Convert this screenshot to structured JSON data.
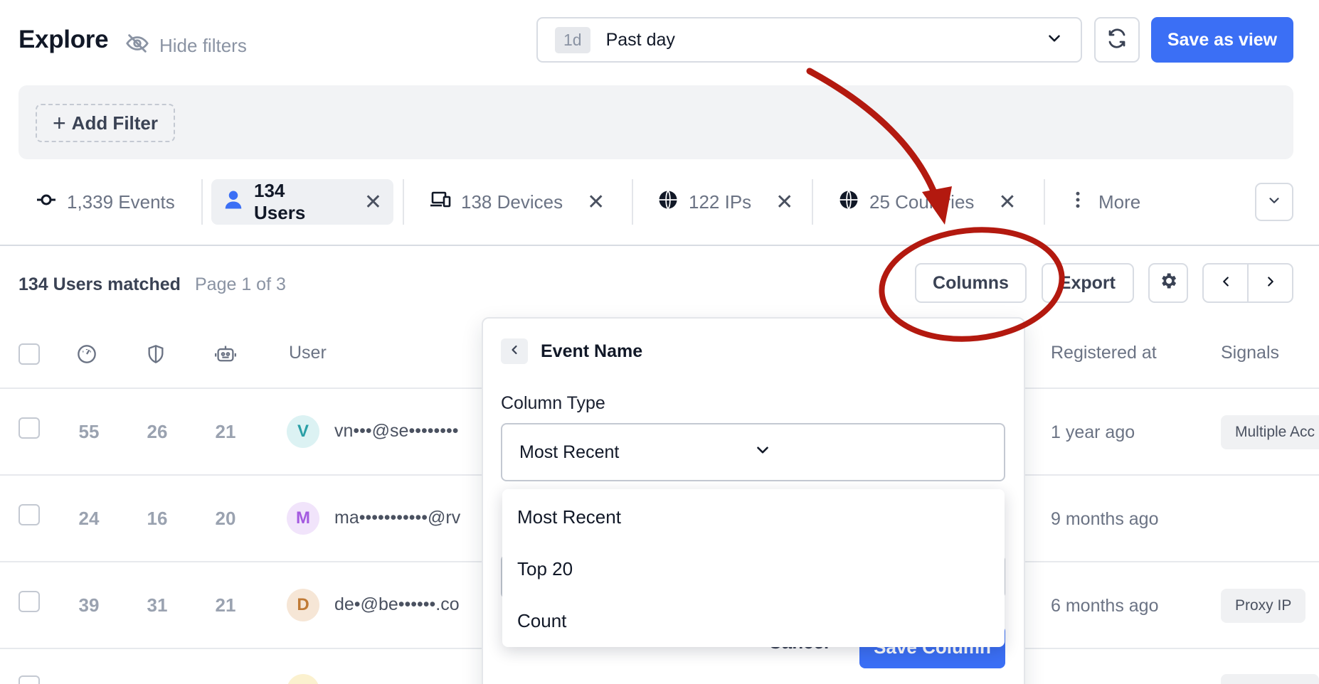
{
  "header": {
    "title": "Explore",
    "hide_filters_label": "Hide filters",
    "time_badge": "1d",
    "time_label": "Past day",
    "save_view_label": "Save as view"
  },
  "filters": {
    "add_filter_label": "Add Filter"
  },
  "tabs": [
    {
      "label": "1,339 Events",
      "icon": "events-icon",
      "closable": false,
      "active": false
    },
    {
      "label": "134 Users",
      "icon": "user-icon",
      "closable": true,
      "active": true
    },
    {
      "label": "138 Devices",
      "icon": "devices-icon",
      "closable": true,
      "active": false
    },
    {
      "label": "122 IPs",
      "icon": "globe-icon",
      "closable": true,
      "active": false
    },
    {
      "label": "25 Countries",
      "icon": "globe-icon",
      "closable": true,
      "active": false
    },
    {
      "label": "More",
      "icon": "more-vertical-icon",
      "closable": false,
      "active": false
    }
  ],
  "results": {
    "matched": "134 Users matched",
    "page_info": "Page 1 of 3",
    "columns_label": "Columns",
    "export_label": "Export"
  },
  "table": {
    "headers": {
      "user": "User",
      "registered": "Registered at",
      "signals": "Signals"
    },
    "rows": [
      {
        "scores": [
          "55",
          "26",
          "21"
        ],
        "avatar": "V",
        "email": "vn•••@se••••••••",
        "registered": "1 year ago",
        "signal": "Multiple Acc"
      },
      {
        "scores": [
          "24",
          "16",
          "20"
        ],
        "avatar": "M",
        "email": "ma•••••••••••@rv",
        "registered": "9 months ago",
        "signal": ""
      },
      {
        "scores": [
          "39",
          "31",
          "21"
        ],
        "avatar": "D",
        "email": "de•@be••••••.co",
        "registered": "6 months ago",
        "signal": "Proxy IP"
      }
    ]
  },
  "column_editor": {
    "title": "Event Name",
    "column_type_label": "Column Type",
    "selected_type": "Most Recent",
    "options": [
      "Most Recent",
      "Top 20",
      "Count"
    ],
    "cancel_label": "Cancel",
    "save_label": "Save Column"
  },
  "colors": {
    "accent": "#3b6ff5",
    "annotation": "#b3190f"
  }
}
